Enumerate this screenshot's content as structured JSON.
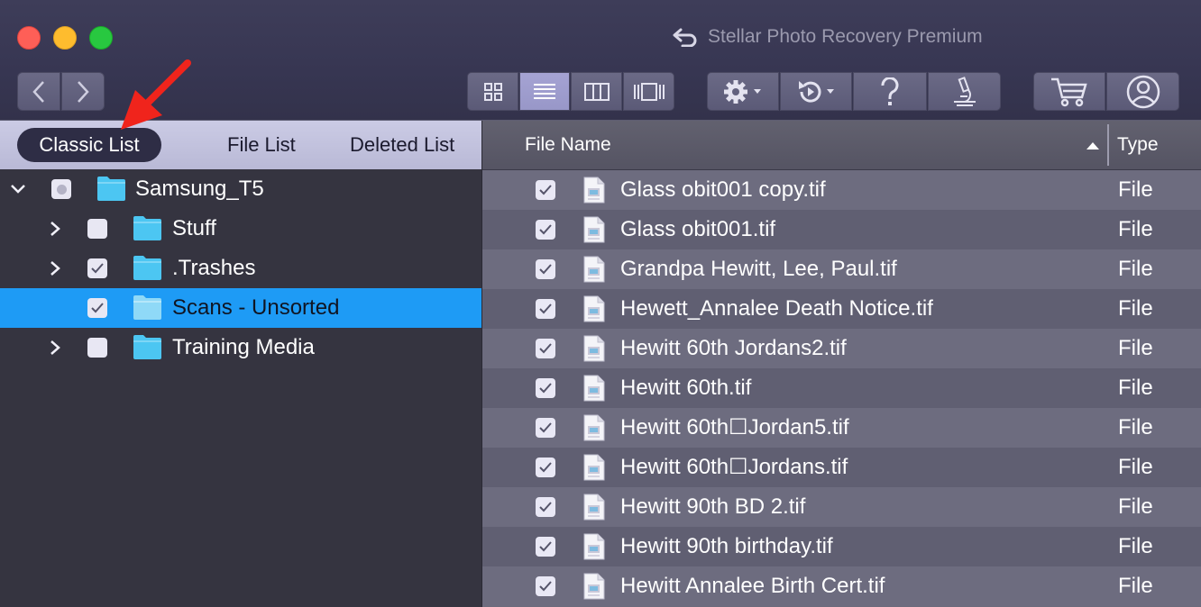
{
  "window": {
    "title": "Stellar Photo Recovery Premium"
  },
  "toolbar": {
    "nav": [
      "chevron-left-icon",
      "chevron-right-icon"
    ],
    "views": [
      "grid-view-icon",
      "list-view-icon",
      "columns-view-icon",
      "coverflow-view-icon"
    ],
    "active_view": "list",
    "actions": [
      "gear-icon",
      "recover-icon",
      "help-icon",
      "analyze-icon"
    ],
    "store": [
      "cart-icon",
      "account-icon"
    ]
  },
  "tabs": {
    "classic": "Classic List",
    "file": "File List",
    "deleted": "Deleted List",
    "active": "Classic List"
  },
  "tree": [
    {
      "label": "Samsung_T5",
      "level": 0,
      "expander": "expanded",
      "check": "partial",
      "selected": false
    },
    {
      "label": "Stuff",
      "level": 1,
      "expander": "collapsed",
      "check": "unchecked",
      "selected": false
    },
    {
      "label": ".Trashes",
      "level": 1,
      "expander": "collapsed",
      "check": "checked",
      "selected": false
    },
    {
      "label": "Scans - Unsorted",
      "level": 1,
      "expander": "none",
      "check": "checked",
      "selected": true
    },
    {
      "label": "Training Media",
      "level": 1,
      "expander": "collapsed",
      "check": "unchecked",
      "selected": false
    }
  ],
  "file_table": {
    "columns": {
      "name": "File Name",
      "type": "Type"
    },
    "sort": "ascending",
    "rows": [
      {
        "name": "Glass obit001 copy.tif",
        "type": "File",
        "checked": true
      },
      {
        "name": "Glass obit001.tif",
        "type": "File",
        "checked": true
      },
      {
        "name": "Grandpa Hewitt, Lee, Paul.tif",
        "type": "File",
        "checked": true
      },
      {
        "name": "Hewett_Annalee Death Notice.tif",
        "type": "File",
        "checked": true
      },
      {
        "name": "Hewitt 60th Jordans2.tif",
        "type": "File",
        "checked": true
      },
      {
        "name": "Hewitt 60th.tif",
        "type": "File",
        "checked": true
      },
      {
        "name": "Hewitt 60th☐Jordan5.tif",
        "type": "File",
        "checked": true
      },
      {
        "name": "Hewitt 60th☐Jordans.tif",
        "type": "File",
        "checked": true
      },
      {
        "name": "Hewitt 90th BD 2.tif",
        "type": "File",
        "checked": true
      },
      {
        "name": "Hewitt 90th birthday.tif",
        "type": "File",
        "checked": true
      },
      {
        "name": "Hewitt Annalee Birth Cert.tif",
        "type": "File",
        "checked": true
      }
    ]
  },
  "colors": {
    "selection": "#1e9bf5",
    "folder": "#4cc6f2",
    "annotation_arrow": "#f0241c"
  }
}
